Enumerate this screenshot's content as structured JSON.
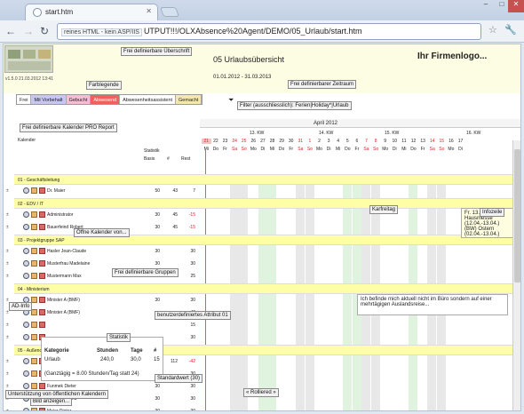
{
  "browser": {
    "tab_title": "start.htm",
    "address_chip": "reines HTML - kein ASP/IIS",
    "address_text": "UTPUT!!!/OLXAbsence%20Agent/DEMO/05_Urlaub/start.htm"
  },
  "header": {
    "version": "v1.5.0  21.03.2012 13:41",
    "title": "05 Urlaubsübersicht",
    "logo": "Ihr Firmenlogo...",
    "range": "01.01.2012 - 31.03.2013"
  },
  "callouts": {
    "ueberschrift": "Frei definierbare Überschrift",
    "farblegende": "Farblegende",
    "zeitraum": "Frei definierbarer Zeitraum",
    "filter": "Filter (ausschliesslich): Ferien|Holiday*|Urlaub",
    "kalender_pro": "Frei definierbare Kalender PRO Report",
    "karfreitag": "Karfreitag",
    "infozeile": "Infozeile",
    "oeffne": "Öffne Kalender von...",
    "gruppen": "Frei definierbare Gruppen",
    "adinfo": "AD-Info",
    "attribut": "benutzerdefiniertes Attribut 01",
    "statistik": "Statistik",
    "bild": "Bild anzeigen...",
    "standardwert": "Standardwert (30)",
    "oeffentlich": "Unterstützung von öffentlichen Kalendern",
    "rolliert": "« Rolliered »"
  },
  "legend": [
    "Frei",
    "Mit Vorbehalt",
    "Gebucht",
    "Abwesend",
    "Abwesenheitsassistent",
    "Gemacht"
  ],
  "legend_colors": [
    "#ffffff",
    "#c7c7f0",
    "#f4bfd4",
    "#f06060",
    "#ffffff",
    "#f5e7b0"
  ],
  "left": {
    "kalender": "Kalender",
    "statistik": "Statistik",
    "basis": "Basis",
    "anzahl": "#",
    "rest": "Rest"
  },
  "month": "April 2012",
  "kw": [
    "13. KW",
    "14. KW",
    "15. KW",
    "16. KW"
  ],
  "day_numbers": [
    "21",
    "22",
    "23",
    "24",
    "25",
    "26",
    "27",
    "28",
    "29",
    "30",
    "31",
    "1",
    "2",
    "3",
    "4",
    "5",
    "6",
    "7",
    "8",
    "9",
    "10",
    "11",
    "12",
    "13",
    "14",
    "15",
    "16",
    "17"
  ],
  "day_names": [
    "Mi",
    "Do",
    "Fr",
    "Sa",
    "So",
    "Mo",
    "Di",
    "Mi",
    "Do",
    "Fr",
    "Sa",
    "So",
    "Mo",
    "Di",
    "Mi",
    "Do",
    "Fr",
    "Sa",
    "So",
    "Mo",
    "Di",
    "Mi",
    "Do",
    "Fr",
    "Sa",
    "So",
    "Mo",
    "Di"
  ],
  "rows": [
    {
      "type": "grp",
      "name": "01 - Geschäftsleitung"
    },
    {
      "type": "p",
      "name": "Dr. Maier",
      "basis": "50",
      "anz": "43",
      "rest": "7"
    },
    {
      "type": "grp",
      "name": "02 - EDV / IT"
    },
    {
      "type": "p",
      "name": "Administrator",
      "basis": "30",
      "anz": "45",
      "rest": "-15"
    },
    {
      "type": "p",
      "name": "Bauerfeind Robert",
      "basis": "30",
      "anz": "45",
      "rest": "-15"
    },
    {
      "type": "grp",
      "name": "03 - Projektgruppe SAP"
    },
    {
      "type": "p",
      "name": "Hasler Jean-Claude",
      "basis": "30",
      "anz": "",
      "rest": "30"
    },
    {
      "type": "p",
      "name": "Musterfrau Madelaine",
      "basis": "30",
      "anz": "",
      "rest": "30"
    },
    {
      "type": "p",
      "name": "Mustermann Max",
      "basis": "25",
      "anz": "",
      "rest": "25"
    },
    {
      "type": "grp",
      "name": "04 - Ministerium"
    },
    {
      "type": "p",
      "name": "Minister A (BMF)",
      "basis": "30",
      "anz": "",
      "rest": "30"
    },
    {
      "type": "p",
      "name": "Minister A (BMF)",
      "basis": "",
      "anz": "",
      "rest": "40"
    },
    {
      "type": "p",
      "name": "",
      "basis": "",
      "anz": "",
      "rest": "15"
    },
    {
      "type": "p",
      "name": "",
      "basis": "",
      "anz": "",
      "rest": "30"
    },
    {
      "type": "grp",
      "name": "05 - Außendienst (Vertrieb Montage)"
    },
    {
      "type": "p",
      "name": "Dr. Müller",
      "basis": "70",
      "anz": "112",
      "rest": "-42"
    },
    {
      "type": "p",
      "name": "",
      "basis": "30",
      "anz": "",
      "rest": "30"
    },
    {
      "type": "p",
      "name": "Funmek Dieter",
      "basis": "30",
      "anz": "",
      "rest": "30"
    },
    {
      "type": "p",
      "name": "Grimaldi Bernd",
      "basis": "30",
      "anz": "",
      "rest": "30"
    },
    {
      "type": "p",
      "name": "Meier Dieter",
      "basis": "30",
      "anz": "",
      "rest": "30"
    }
  ],
  "popups": {
    "infodate": "Fr. 13.04.2012",
    "info1": "Hausmesse (12.04.-13.04.)",
    "info2": "(BW) Ostern (02.04.-13.04.)",
    "note": "Ich befinde mich aktuell nicht im Büro sondern auf einer mehrtägigen Auslandsreise...",
    "stat_kategorie": "Kategorie",
    "stat_stunden": "Stunden",
    "stat_tage": "Tage",
    "stat_anz": "#",
    "stat_urlaub": "Urlaub",
    "stat_h": "240,0",
    "stat_t": "30,0",
    "stat_n": "15",
    "stat_foot": "(Ganztägig = 8.00 Stunden/Tag statt 24)"
  }
}
